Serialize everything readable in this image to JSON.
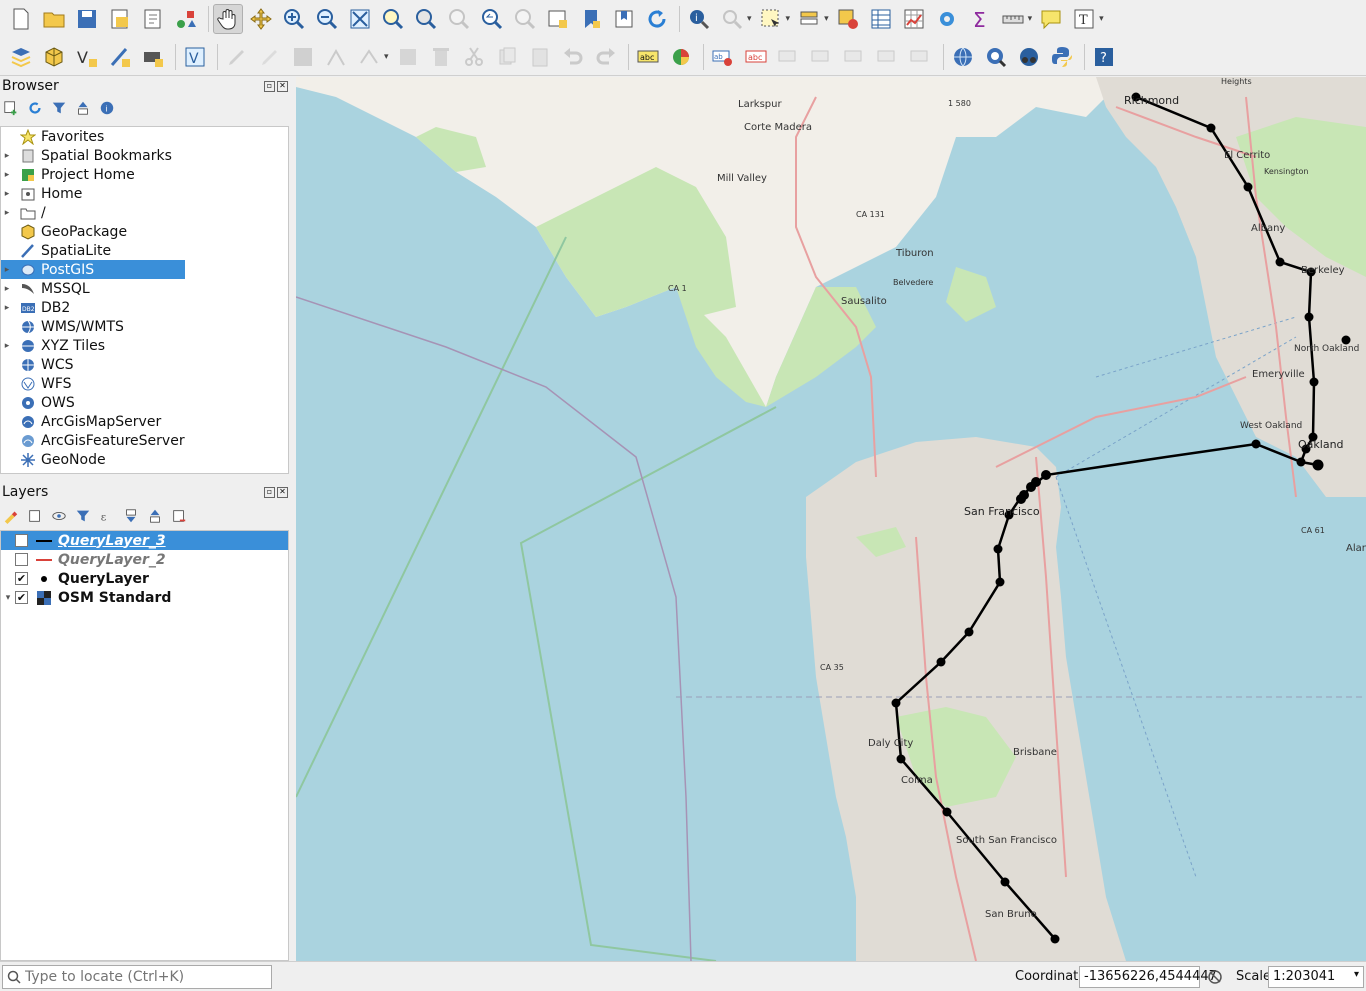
{
  "browser": {
    "title": "Browser",
    "items": [
      {
        "label": "Favorites",
        "icon": "star-icon",
        "arrow": ""
      },
      {
        "label": "Spatial Bookmarks",
        "icon": "bookmarks-icon",
        "arrow": "▸"
      },
      {
        "label": "Project Home",
        "icon": "project-home-icon",
        "arrow": "▸"
      },
      {
        "label": "Home",
        "icon": "home-icon",
        "arrow": "▸"
      },
      {
        "label": "/",
        "icon": "folder-icon",
        "arrow": "▸"
      },
      {
        "label": "GeoPackage",
        "icon": "geopackage-icon",
        "arrow": ""
      },
      {
        "label": "SpatiaLite",
        "icon": "spatialite-icon",
        "arrow": ""
      },
      {
        "label": "PostGIS",
        "icon": "postgis-icon",
        "arrow": "▸"
      },
      {
        "label": "MSSQL",
        "icon": "mssql-icon",
        "arrow": "▸"
      },
      {
        "label": "DB2",
        "icon": "db2-icon",
        "arrow": "▸"
      },
      {
        "label": "WMS/WMTS",
        "icon": "wms-icon",
        "arrow": ""
      },
      {
        "label": "XYZ Tiles",
        "icon": "xyz-icon",
        "arrow": "▸"
      },
      {
        "label": "WCS",
        "icon": "wcs-icon",
        "arrow": ""
      },
      {
        "label": "WFS",
        "icon": "wfs-icon",
        "arrow": ""
      },
      {
        "label": "OWS",
        "icon": "ows-icon",
        "arrow": ""
      },
      {
        "label": "ArcGisMapServer",
        "icon": "arcgis-mapserver-icon",
        "arrow": ""
      },
      {
        "label": "ArcGisFeatureServer",
        "icon": "arcgis-featureserver-icon",
        "arrow": ""
      },
      {
        "label": "GeoNode",
        "icon": "geonode-icon",
        "arrow": ""
      }
    ],
    "selected": "PostGIS"
  },
  "layers": {
    "title": "Layers",
    "items": [
      {
        "label": "QueryLayer_3",
        "checked": true,
        "symbol": "line-black",
        "selected": true
      },
      {
        "label": "QueryLayer_2",
        "checked": false,
        "symbol": "line-red",
        "selected": false
      },
      {
        "label": "QueryLayer",
        "checked": true,
        "symbol": "point-black",
        "selected": false
      },
      {
        "label": "OSM Standard",
        "checked": true,
        "symbol": "raster-tile",
        "selected": false
      }
    ]
  },
  "map_labels": [
    "Larkspur",
    "Corte Madera",
    "Mill Valley",
    "Tiburon",
    "Belvedere",
    "Sausalito",
    "Richmond",
    "El Cerrito",
    "Albany",
    "Berkeley",
    "North Oakland",
    "Emeryville",
    "West Oakland",
    "Oakland",
    "San Francisco",
    "Daly City",
    "Brisbane",
    "Colma",
    "South San Francisco",
    "San Bruno",
    "Kensington",
    "Alan",
    "CA 131",
    "CA 1",
    "CA 35",
    "CA 61",
    "1 580",
    "Heights"
  ],
  "status": {
    "locator_placeholder": "Type to locate (Ctrl+K)",
    "coordinate_label": "Coordinate",
    "coordinate_value": "-13656226,4544447",
    "scale_label": "Scale",
    "scale_value": "1:203041"
  },
  "colors": {
    "water": "#aad3df",
    "land": "#f2efe9",
    "park": "#c8e6b5",
    "urban": "#e0dcd5",
    "route": "#000000",
    "selection": "#3a8fd9"
  }
}
